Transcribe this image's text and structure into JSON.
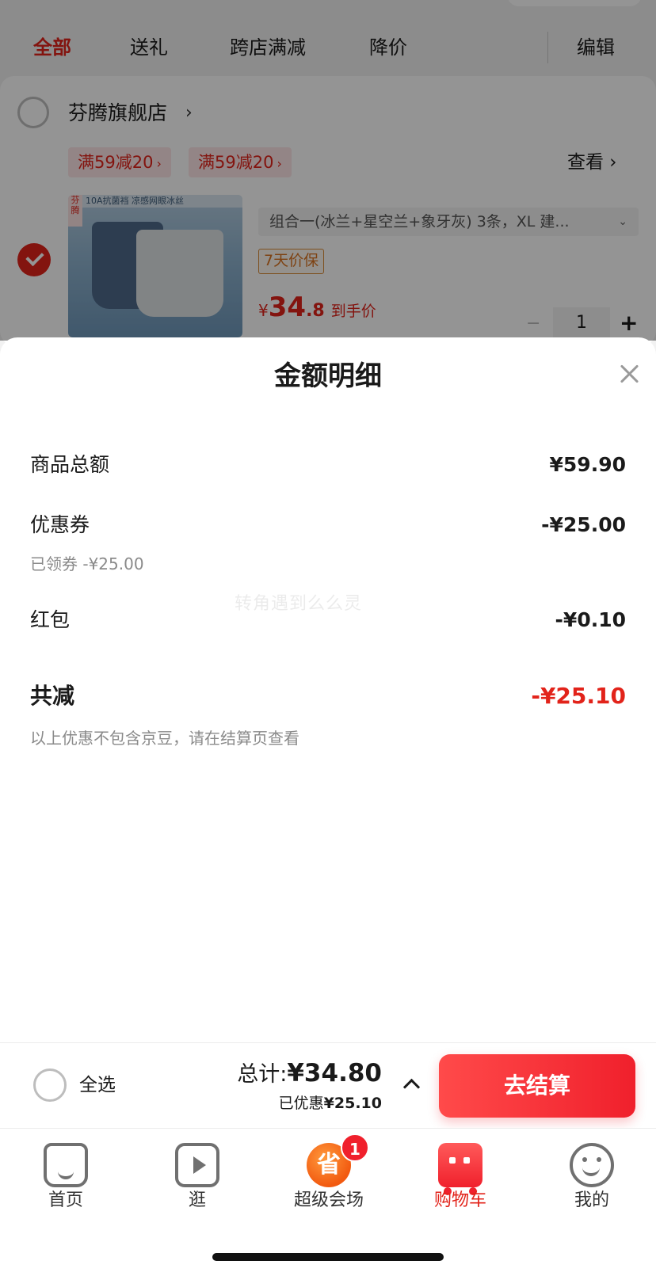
{
  "filter_tabs": [
    {
      "label": "全部",
      "active": true
    },
    {
      "label": "送礼",
      "active": false
    },
    {
      "label": "跨店满减",
      "active": false
    },
    {
      "label": "降价",
      "active": false
    }
  ],
  "edit_label": "编辑",
  "store": {
    "name": "芬腾旗舰店",
    "promos": [
      "满59减20",
      "满59减20"
    ],
    "view_label": "查看"
  },
  "product": {
    "image_caption": "10A抗菌裆 凉感网眼冰丝",
    "image_tag": "芬腾",
    "spec": "组合一(冰兰+星空兰+象牙灰) 3条，XL 建...",
    "guarantee": "7天价保",
    "price_symbol": "¥",
    "price_int": "34",
    "price_dec": ".8",
    "price_label": "到手价",
    "quantity": "1"
  },
  "modal": {
    "title": "金额明细",
    "rows": [
      {
        "label": "商品总额",
        "value": "¥59.90"
      },
      {
        "label": "优惠券",
        "value": "-¥25.00",
        "sub": "已领券 -¥25.00"
      },
      {
        "label": "红包",
        "value": "-¥0.10"
      }
    ],
    "total_label": "共减",
    "total_value": "-¥25.10",
    "note": "以上优惠不包含京豆，请在结算页查看",
    "watermark": "转角遇到么么灵"
  },
  "checkout": {
    "select_all": "全选",
    "total_prefix": "总计:",
    "total": "¥34.80",
    "saved_prefix": "已优惠",
    "saved": "¥25.10",
    "button": "去结算"
  },
  "tabbar": [
    {
      "label": "首页",
      "icon": "home-icon"
    },
    {
      "label": "逛",
      "icon": "video-icon"
    },
    {
      "label": "超级会场",
      "icon": "super-venue-icon",
      "badge": "1",
      "glyph": "省"
    },
    {
      "label": "购物车",
      "icon": "cart-icon",
      "active": true
    },
    {
      "label": "我的",
      "icon": "profile-icon"
    }
  ],
  "colors": {
    "accent": "#e2231a",
    "checkout_button": "#f0202c",
    "promo_bg": "#fde6e7"
  }
}
